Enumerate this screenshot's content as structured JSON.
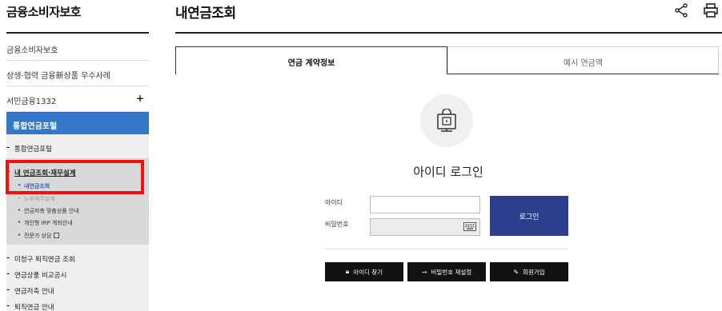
{
  "sidebar": {
    "title": "금융소비자보호",
    "items": [
      {
        "label": "금융소비자보호"
      },
      {
        "label": "상생·협력 금융新상품 우수사례"
      },
      {
        "label": "서민금융1332",
        "expand": "+"
      }
    ],
    "active_label": "통합연금포털",
    "sub_items": [
      {
        "label": "통합연금포털"
      },
      {
        "label": "내 연금조회·재무설계"
      },
      {
        "label": "미청구 퇴직연금 조회"
      },
      {
        "label": "연금상품 비교공시"
      },
      {
        "label": "연금저축 안내"
      },
      {
        "label": "퇴직연금 안내"
      }
    ],
    "sub_sub_items": [
      {
        "label": "내연금조회"
      },
      {
        "label": "노후재무설계"
      },
      {
        "label": "연금저축 맞춤상품 안내"
      },
      {
        "label": "개인형 IRP 계좌안내"
      },
      {
        "label": "전문가 상담"
      }
    ]
  },
  "main": {
    "title": "내연금조회",
    "tabs": [
      {
        "label": "연금 계약정보",
        "active": true
      },
      {
        "label": "예시 연금액",
        "active": false
      }
    ],
    "login": {
      "title": "아이디 로그인",
      "id_label": "아이디",
      "pw_label": "비밀번호",
      "id_value": "",
      "pw_value": "",
      "login_button": "로그인"
    },
    "actions": [
      {
        "label": "아이디 찾기",
        "icon": "lock-icon"
      },
      {
        "label": "비밀번호 재설정",
        "icon": "key-icon"
      },
      {
        "label": "회원가입",
        "icon": "pencil-icon"
      }
    ]
  },
  "colors": {
    "active_nav": "#3477c8",
    "login_button": "#2c3f8c",
    "highlight_box": "#f01010",
    "action_button": "#111111"
  }
}
